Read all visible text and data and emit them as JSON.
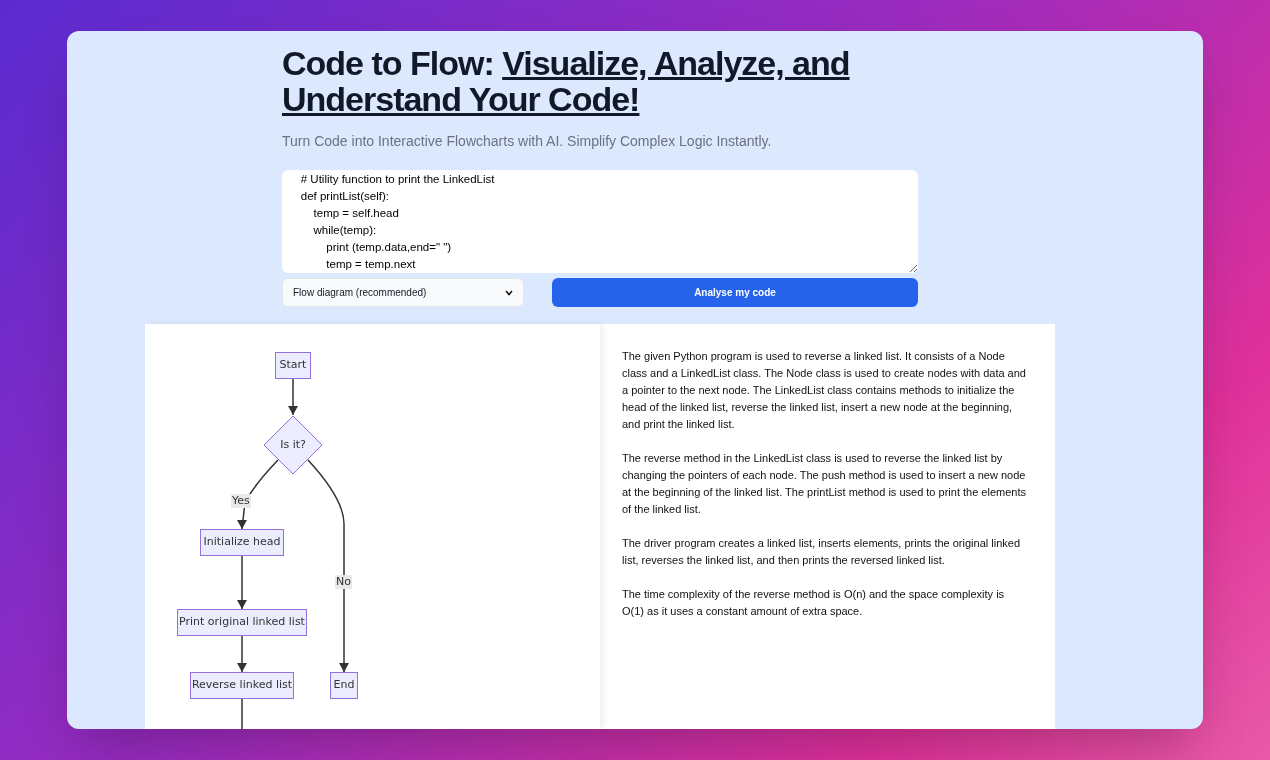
{
  "header": {
    "title_plain": "Code to Flow: ",
    "title_link_lines": [
      "Visualize, Analyze, and",
      "Understand Your Code!"
    ],
    "subtitle": "Turn Code into Interactive Flowcharts with AI. Simplify Complex Logic Instantly."
  },
  "code": {
    "value": "    # Utility function to print the LinkedList\n    def printList(self):\n        temp = self.head\n        while(temp):\n            print (temp.data,end=\" \")\n            temp = temp.next"
  },
  "diagram_type": {
    "value": "Flow diagram (recommended)"
  },
  "analyse_button": "Analyse my code",
  "flowchart": {
    "nodes": [
      {
        "kind": "process",
        "label": "Start"
      },
      {
        "kind": "decision",
        "label": "Is it?"
      },
      {
        "kind": "process",
        "label": "Initialize head"
      },
      {
        "kind": "process",
        "label": "Print original linked list"
      },
      {
        "kind": "process",
        "label": "Reverse linked list"
      },
      {
        "kind": "process",
        "label": "End"
      }
    ],
    "edge_labels": [
      "Yes",
      "No"
    ]
  },
  "explanation": [
    "The given Python program is used to reverse a linked list. It consists of a Node class and a LinkedList class. The Node class is used to create nodes with data and a pointer to the next node. The LinkedList class contains methods to initialize the head of the linked list, reverse the linked list, insert a new node at the beginning, and print the linked list.",
    "The reverse method in the LinkedList class is used to reverse the linked list by changing the pointers of each node. The push method is used to insert a new node at the beginning of the linked list. The printList method is used to print the elements of the linked list.",
    "The driver program creates a linked list, inserts elements, prints the original linked list, reverses the linked list, and then prints the reversed linked list.",
    "The time complexity of the reverse method is O(n) and the space complexity is O(1) as it uses a constant amount of extra space."
  ]
}
